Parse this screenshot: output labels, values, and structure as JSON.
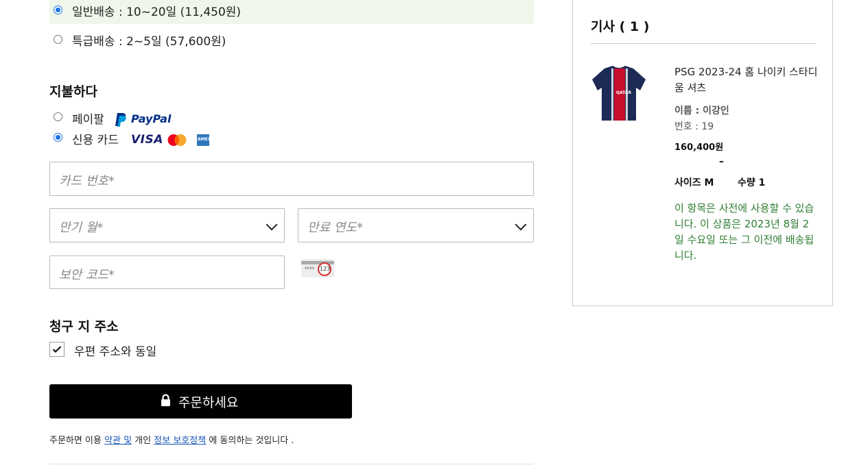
{
  "shipping": {
    "standard_label": "일반배송 : 10~20일 (11,450원)",
    "express_label": "특급배송 : 2~5일 (57,600원)"
  },
  "payment": {
    "heading": "지불하다",
    "paypal_label": "페이팔",
    "paypal_logo": "PayPal",
    "card_label": "신용 카드",
    "visa_logo": "VISA",
    "amex_logo": "AMEX",
    "card_number_placeholder": "카드 번호*",
    "exp_month_placeholder": "만기 월*",
    "exp_year_placeholder": "만료 연도*",
    "cvv_placeholder": "보안 코드*",
    "cvv_hint_text": "xxxx",
    "cvv_hint_number": "123"
  },
  "billing": {
    "heading": "청구 지 주소",
    "same_as_shipping": "우편 주소와 동일"
  },
  "order": {
    "button_label": "주문하세요",
    "legal_prefix": "주문하면 이용",
    "legal_terms": "약관 및",
    "legal_mid": "개인",
    "legal_privacy": "정보 보호정책",
    "legal_suffix": "에 동의하는 것입니다 ."
  },
  "cart": {
    "heading": "기사 ( 1 )",
    "item": {
      "name": "PSG 2023-24 홈 나이키 스타디움 셔츠",
      "player_name": "이름 : 이강인",
      "player_number": "번호 : 19",
      "price": "160,400원",
      "dash": "–",
      "size": "사이즈 M",
      "qty": "수량 1",
      "availability": "이 항목은 사전에 사용할 수 있습니다. 이 상품은 2023년 8월 2일 수요일 또는 그 이전에 배송됩니다.",
      "jersey_sponsor": "QATAR"
    }
  },
  "colors": {
    "accent": "#1a73e8",
    "stock": "#2e7d32",
    "selected_bg": "#eef7e9"
  }
}
